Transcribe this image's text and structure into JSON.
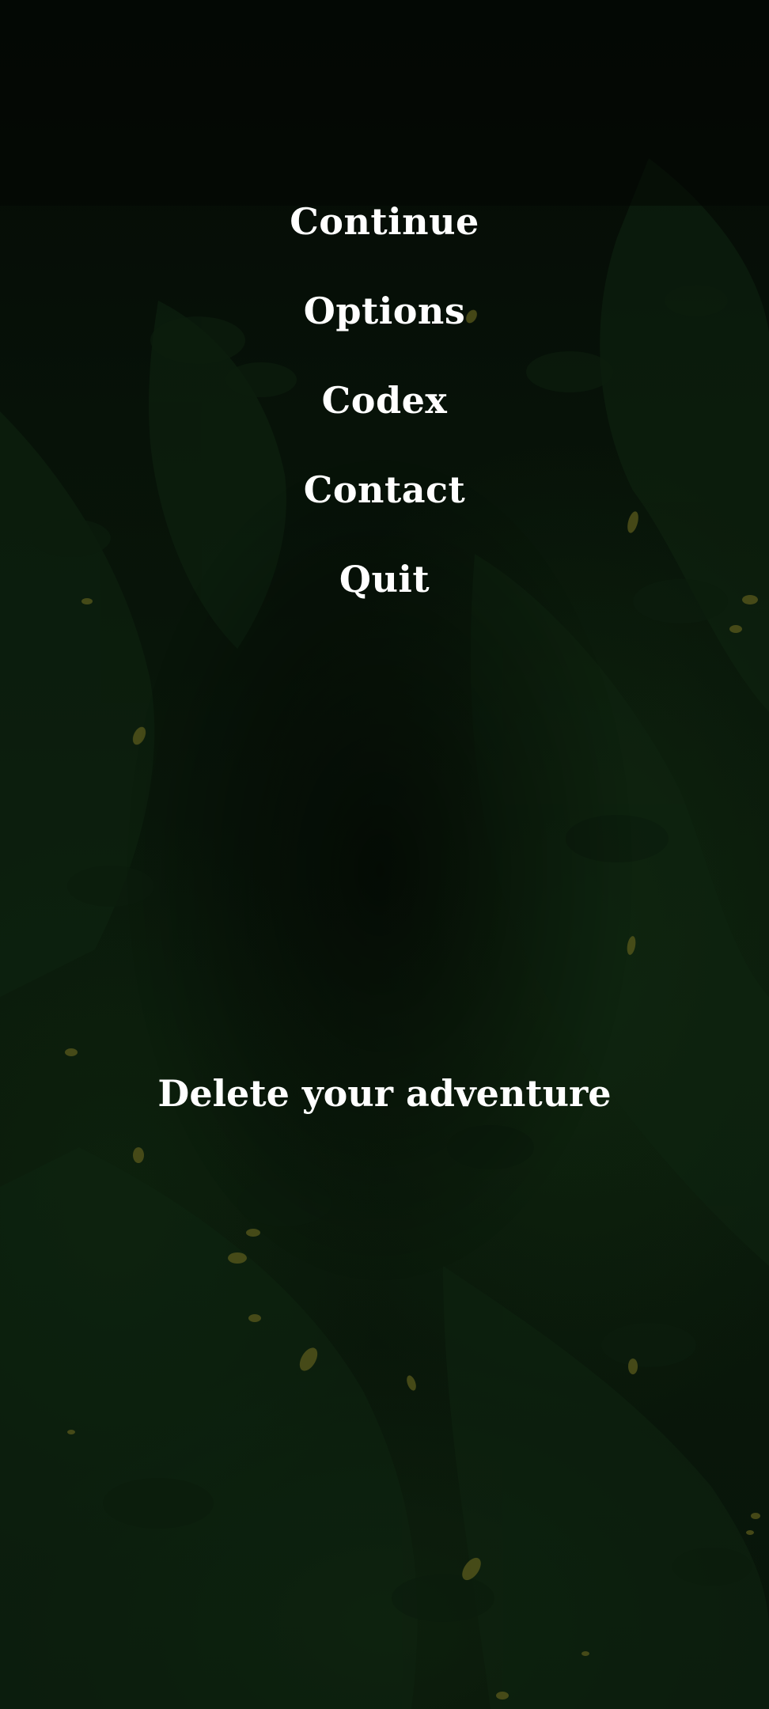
{
  "menu": {
    "items": [
      {
        "id": "continue",
        "label": "Continue"
      },
      {
        "id": "options",
        "label": "Options"
      },
      {
        "id": "codex",
        "label": "Codex"
      },
      {
        "id": "contact",
        "label": "Contact"
      },
      {
        "id": "quit",
        "label": "Quit"
      }
    ]
  },
  "delete": {
    "label": "Delete your adventure"
  },
  "colors": {
    "background": "#040a05",
    "foliage": "#0f2410",
    "leaf_accent": "#5a5a1c",
    "text": "#ffffff"
  }
}
